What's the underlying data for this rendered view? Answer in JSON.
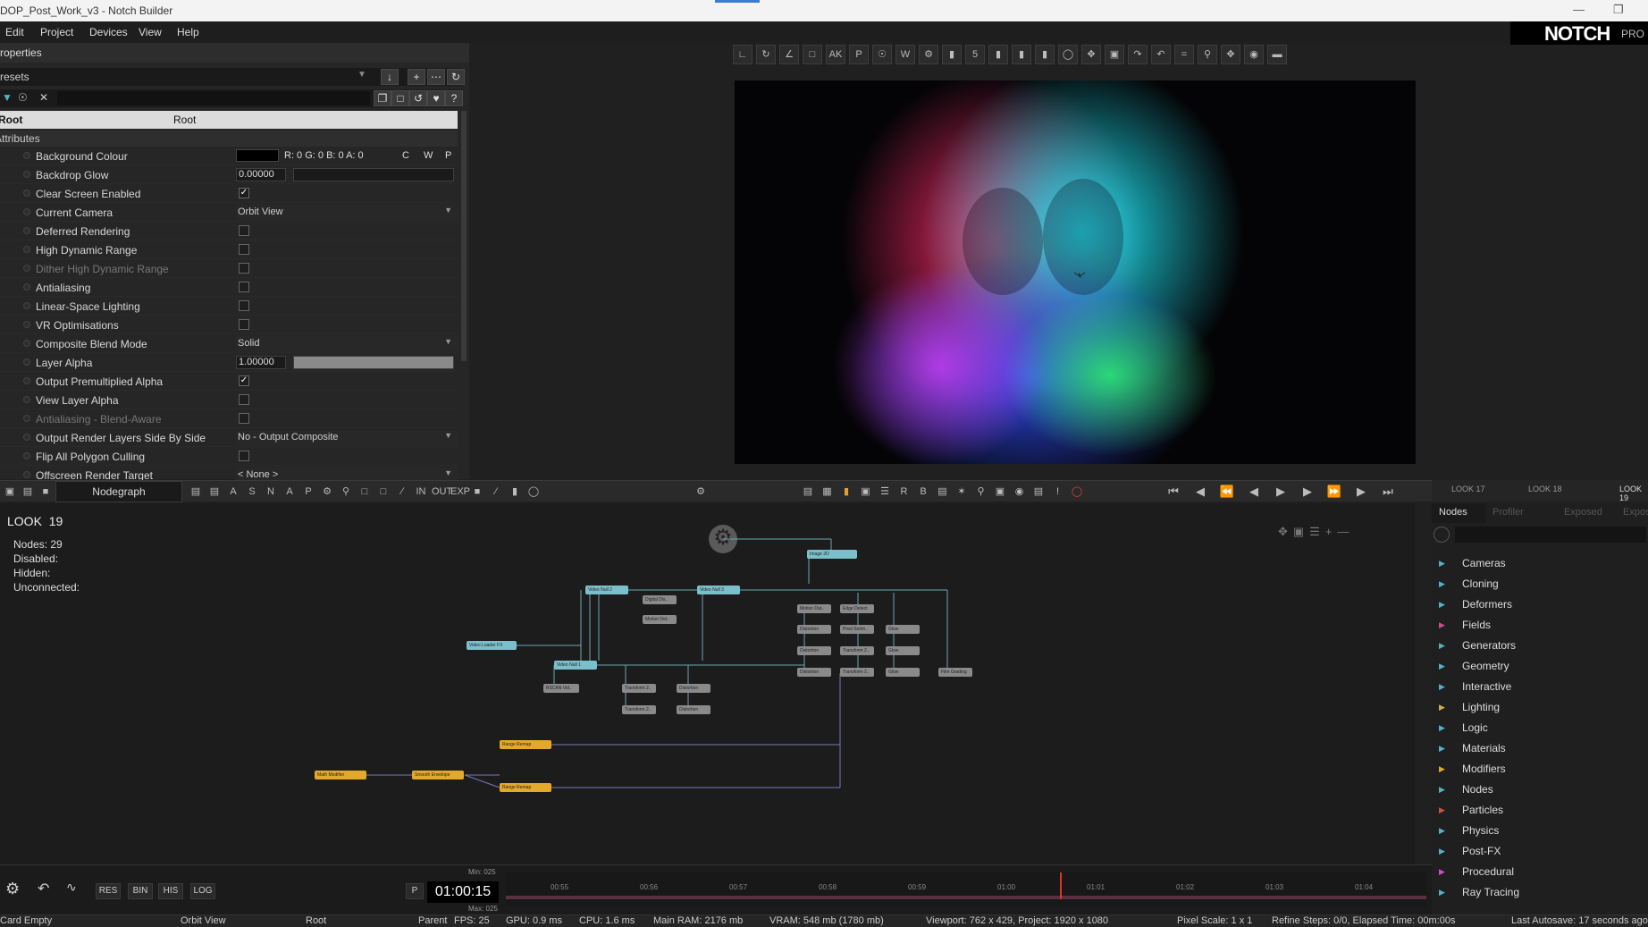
{
  "window": {
    "title": "DOP_Post_Work_v3 - Notch Builder"
  },
  "menu": {
    "items": [
      "Edit",
      "Project",
      "Devices",
      "View",
      "Help"
    ]
  },
  "logo": {
    "name": "NOTCH",
    "tier": "PRO"
  },
  "properties": {
    "header": "Properties",
    "presets_label": "Presets",
    "root_col1": "Root",
    "root_col2": "Root",
    "attributes_label": "Attributes",
    "rows": [
      {
        "label": "Background Colour",
        "type": "color",
        "value": "R: 0 G: 0 B: 0 A: 0",
        "extras": [
          "C",
          "W",
          "P"
        ]
      },
      {
        "label": "Backdrop Glow",
        "type": "number",
        "value": "0.00000"
      },
      {
        "label": "Clear Screen Enabled",
        "type": "check",
        "checked": true
      },
      {
        "label": "Current Camera",
        "type": "dropdown",
        "value": "Orbit View"
      },
      {
        "label": "Deferred Rendering",
        "type": "check",
        "checked": false
      },
      {
        "label": "High Dynamic Range",
        "type": "check",
        "checked": false
      },
      {
        "label": "Dither High Dynamic Range",
        "type": "check",
        "checked": false,
        "dim": true
      },
      {
        "label": "Antialiasing",
        "type": "check",
        "checked": false
      },
      {
        "label": "Linear-Space Lighting",
        "type": "check",
        "checked": false
      },
      {
        "label": "VR Optimisations",
        "type": "check",
        "checked": false
      },
      {
        "label": "Composite Blend Mode",
        "type": "dropdown",
        "value": "Solid"
      },
      {
        "label": "Layer Alpha",
        "type": "number",
        "value": "1.00000",
        "slider_fill": 1.0
      },
      {
        "label": "Output Premultiplied Alpha",
        "type": "check",
        "checked": true
      },
      {
        "label": "View Layer Alpha",
        "type": "check",
        "checked": false
      },
      {
        "label": "Antialiasing - Blend-Aware",
        "type": "check",
        "checked": false,
        "dim": true
      },
      {
        "label": "Output Render Layers Side By Side",
        "type": "dropdown",
        "value": "No - Output Composite"
      },
      {
        "label": "Flip All Polygon Culling",
        "type": "check",
        "checked": false
      },
      {
        "label": "Offscreen Render Target",
        "type": "dropdown",
        "value": "< None >"
      }
    ]
  },
  "nodegraph": {
    "tab_label": "Nodegraph",
    "look_label": "LOOK",
    "look_number": "19",
    "stats": {
      "nodes": "Nodes:  29",
      "disabled": "Disabled:",
      "hidden": "Hidden:",
      "unconnected": "Unconnected:"
    },
    "nodes": [
      {
        "label": "Image 2D",
        "color": "b"
      },
      {
        "label": "Video Null 2",
        "color": "b"
      },
      {
        "label": "Video Null 3",
        "color": "b"
      },
      {
        "label": "Video Loader FX",
        "color": "b"
      },
      {
        "label": "Video Null 1",
        "color": "b"
      },
      {
        "label": "Digital Dis..",
        "color": "g"
      },
      {
        "label": "Motion Det..",
        "color": "g"
      },
      {
        "label": "Motion Dat..",
        "color": "g"
      },
      {
        "label": "Edge Detect",
        "color": "g"
      },
      {
        "label": "Distortion",
        "color": "g"
      },
      {
        "label": "Pixel Sortin..",
        "color": "g"
      },
      {
        "label": "Glow",
        "color": "g"
      },
      {
        "label": "Distortion",
        "color": "g"
      },
      {
        "label": "Transform 2..",
        "color": "g"
      },
      {
        "label": "Glow",
        "color": "g"
      },
      {
        "label": "Distortion",
        "color": "g"
      },
      {
        "label": "Transform 2..",
        "color": "g"
      },
      {
        "label": "Glow",
        "color": "g"
      },
      {
        "label": "Film Grading",
        "color": "g"
      },
      {
        "label": "RSCAN Vid..",
        "color": "g"
      },
      {
        "label": "Transform 2..",
        "color": "g"
      },
      {
        "label": "Distortion",
        "color": "g"
      },
      {
        "label": "Transform 2..",
        "color": "g"
      },
      {
        "label": "Distortion",
        "color": "g"
      },
      {
        "label": "Range Remap",
        "color": "o"
      },
      {
        "label": "Math Modifier",
        "color": "o"
      },
      {
        "label": "Smooth Envelope",
        "color": "o"
      },
      {
        "label": "Range Remap",
        "color": "o"
      }
    ]
  },
  "looks": {
    "tabs": [
      "LOOK 17",
      "LOOK 18",
      "LOOK 19"
    ]
  },
  "library": {
    "tabs": [
      "Nodes",
      "Profiler",
      "Exposed",
      "Exposed"
    ],
    "categories": [
      {
        "label": "Cameras",
        "color": "#4fb3c8"
      },
      {
        "label": "Cloning",
        "color": "#4fb3c8"
      },
      {
        "label": "Deformers",
        "color": "#4fb3c8"
      },
      {
        "label": "Fields",
        "color": "#c84f8a"
      },
      {
        "label": "Generators",
        "color": "#4fb3c8"
      },
      {
        "label": "Geometry",
        "color": "#4fb3c8"
      },
      {
        "label": "Interactive",
        "color": "#4fb3c8"
      },
      {
        "label": "Lighting",
        "color": "#d0b040"
      },
      {
        "label": "Logic",
        "color": "#4fb3c8"
      },
      {
        "label": "Materials",
        "color": "#4fb3c8"
      },
      {
        "label": "Modifiers",
        "color": "#e3a92a"
      },
      {
        "label": "Nodes",
        "color": "#4fb3c8"
      },
      {
        "label": "Particles",
        "color": "#d05040"
      },
      {
        "label": "Physics",
        "color": "#4fb3c8"
      },
      {
        "label": "Post-FX",
        "color": "#4fb3c8"
      },
      {
        "label": "Procedural",
        "color": "#c84fc8"
      },
      {
        "label": "Ray Tracing",
        "color": "#4fb3c8"
      }
    ]
  },
  "timeline": {
    "buttons": [
      "RES",
      "BIN",
      "HIS",
      "LOG"
    ],
    "p_label": "P",
    "timecode": "01:00:15",
    "min_label": "Min: 025",
    "max_label": "Max: 025",
    "ticks": [
      "00:55",
      "00:56",
      "00:57",
      "00:58",
      "00:59",
      "01:00",
      "01:01",
      "01:02",
      "01:03",
      "01:04"
    ]
  },
  "status": {
    "items": [
      "Card Empty",
      "Orbit View",
      "Root",
      "Parent",
      "FPS: 25",
      "GPU: 0.9 ms",
      "CPU: 1.6 ms",
      "Main RAM: 2176 mb",
      "VRAM: 548 mb (1780 mb)",
      "Viewport: 762 x 429, Project: 1920 x 1080",
      "Pixel Scale: 1 x 1",
      "Refine Steps: 0/0, Elapsed Time: 00m:00s",
      "Last Autosave: 17 seconds ago"
    ]
  },
  "icons": {
    "viewport_toolbar": [
      "axis-icon",
      "rotate-icon",
      "scale-icon",
      "crop-icon",
      "ak-icon",
      "p-icon",
      "target-icon",
      "w-icon",
      "gear-icon",
      "grid-icon",
      "5-icon",
      "pos-icon",
      "rot-icon",
      "scl-icon",
      "circle-icon",
      "move-icon",
      "fit-icon",
      "undo-icon",
      "redo-icon",
      "equal-icon",
      "zoom-icon",
      "pan-icon",
      "camera-icon",
      "bar-icon"
    ]
  }
}
